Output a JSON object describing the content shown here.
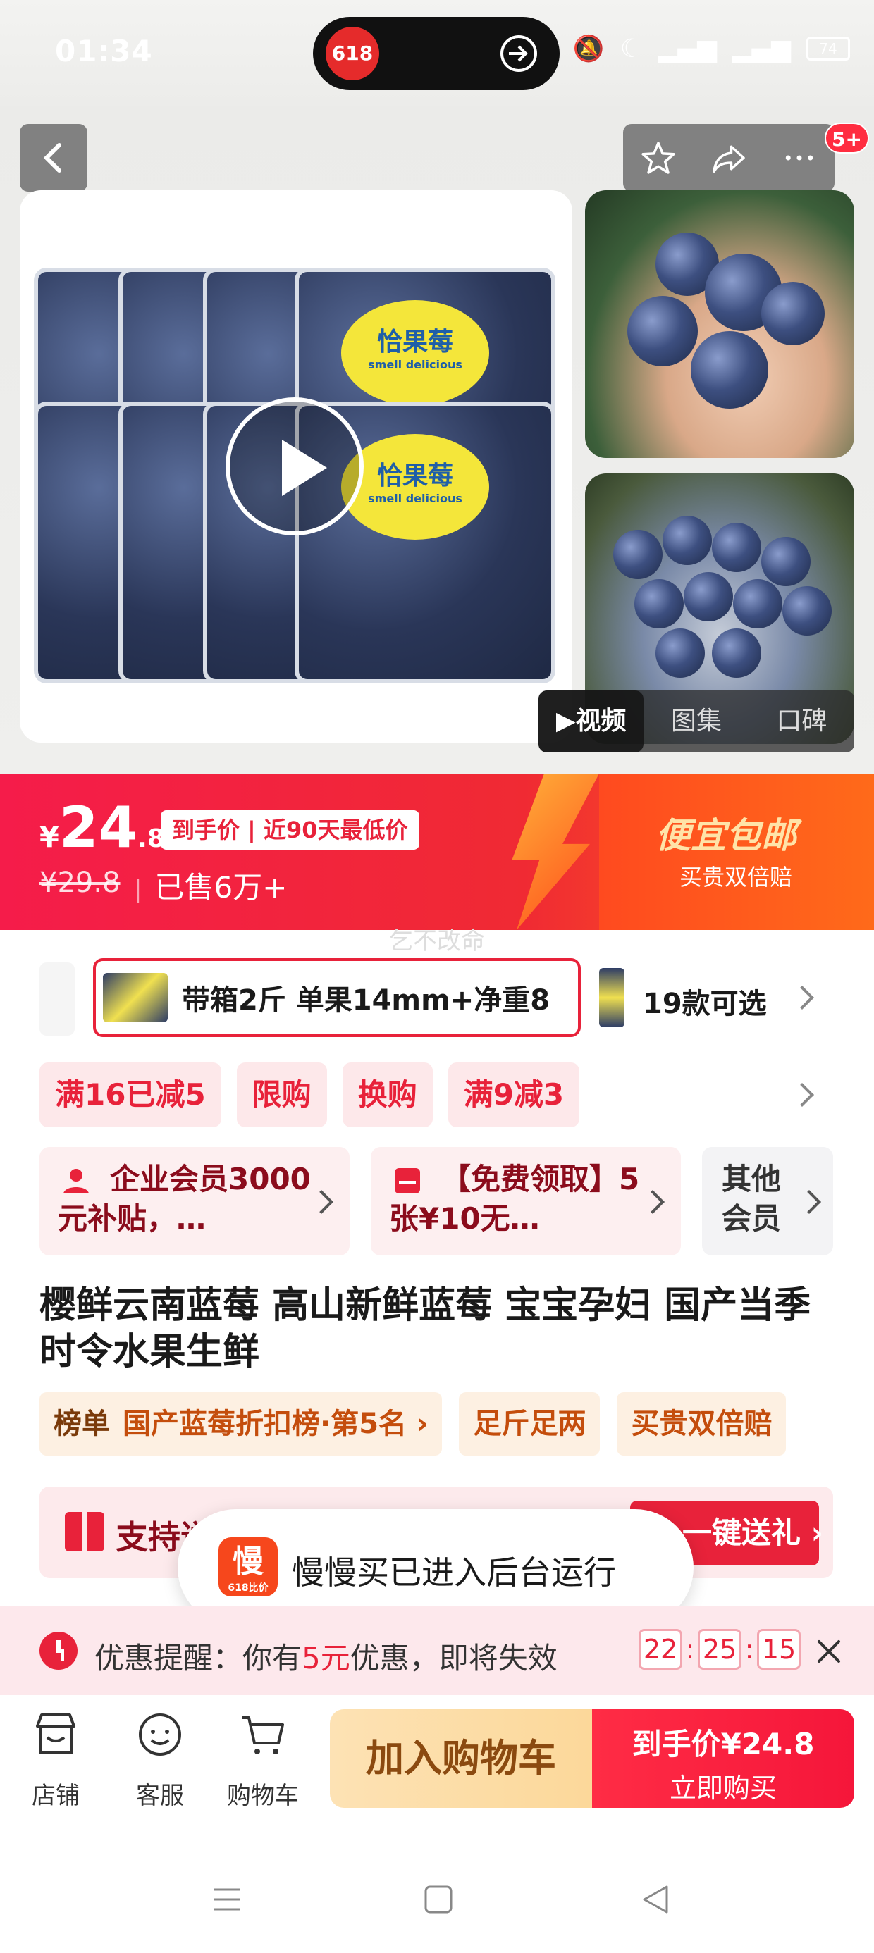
{
  "status_bar": {
    "time": "01:34",
    "pill_app_label": "618",
    "battery": "74"
  },
  "top_actions": {
    "badge": "5+"
  },
  "main_image": {
    "brand": "恰果莓",
    "tagline": "smell delicious"
  },
  "media_tabs": [
    {
      "label": "▶视频",
      "active": true
    },
    {
      "label": "图集",
      "active": false
    },
    {
      "label": "口碑",
      "active": false
    }
  ],
  "price": {
    "currency": "¥",
    "integer": "24",
    "decimal": ".8",
    "tag": "到手价 | 近90天最低价",
    "original": "¥29.8",
    "sold": "已售6万+",
    "promo_title": "便宜包邮",
    "promo_sub": "买贵双倍赔"
  },
  "watermark": "乞不改命",
  "sku": {
    "selected_label": "带箱2斤 单果14mm+净重8",
    "count_label": "19款可选"
  },
  "discount_chips": [
    "满16已减5",
    "限购",
    "换购",
    "满9减3"
  ],
  "benefits": [
    {
      "text": "企业会员3000元补贴，…",
      "icon": "user-icon"
    },
    {
      "text": "【免费领取】5张¥10无…",
      "icon": "coupon-icon"
    }
  ],
  "benefit_other": "其他会员",
  "title": "樱鲜云南蓝莓 高山新鲜蓝莓 宝宝孕妇 国产当季时令水果生鲜",
  "rank_tags": {
    "rank_lead": "榜单",
    "rank_text": "国产蓝莓折扣榜·第5名",
    "tag2": "足斤足两",
    "tag3": "买贵双倍赔"
  },
  "gift": {
    "text": "支持送",
    "button": "一键送礼"
  },
  "toast": {
    "logo_char": "慢",
    "logo_sub": "618比价",
    "message": "慢慢买已进入后台运行"
  },
  "reminder": {
    "prefix": "优惠提醒：你有",
    "highlight": "5元",
    "suffix": "优惠，即将失效",
    "timer": {
      "h": "22",
      "m": "25",
      "s": "15"
    }
  },
  "bottom_bar": {
    "shop": "店铺",
    "service": "客服",
    "cart": "购物车",
    "add_to_cart": "加入购物车",
    "buy_line1": "到手价¥24.8",
    "buy_line2": "立即购买"
  },
  "colors": {
    "accent": "#e8223a",
    "price_band_start": "#f51c4a",
    "price_band_end": "#ff6a1a",
    "cart_button": "#fcd89a"
  }
}
